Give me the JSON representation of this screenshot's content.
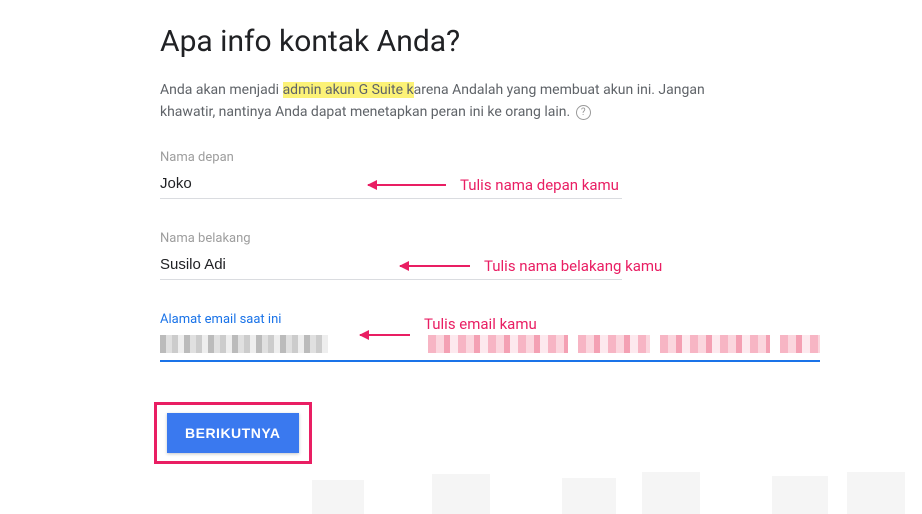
{
  "title": "Apa info kontak Anda?",
  "description": {
    "part1": "Anda akan menjadi ",
    "highlighted": "admin akun G Suite k",
    "part2": "arena Andalah yang membuat akun ini. Jangan khawatir, nantinya Anda dapat menetapkan peran ini ke orang lain."
  },
  "fields": {
    "firstName": {
      "label": "Nama depan",
      "value": "Joko",
      "annotation": "Tulis nama depan kamu"
    },
    "lastName": {
      "label": "Nama belakang",
      "value": "Susilo Adi",
      "annotation": "Tulis nama belakang kamu"
    },
    "email": {
      "label": "Alamat email saat ini",
      "value": "",
      "annotation": "Tulis email kamu"
    }
  },
  "button": {
    "next": "BERIKUTNYA"
  }
}
